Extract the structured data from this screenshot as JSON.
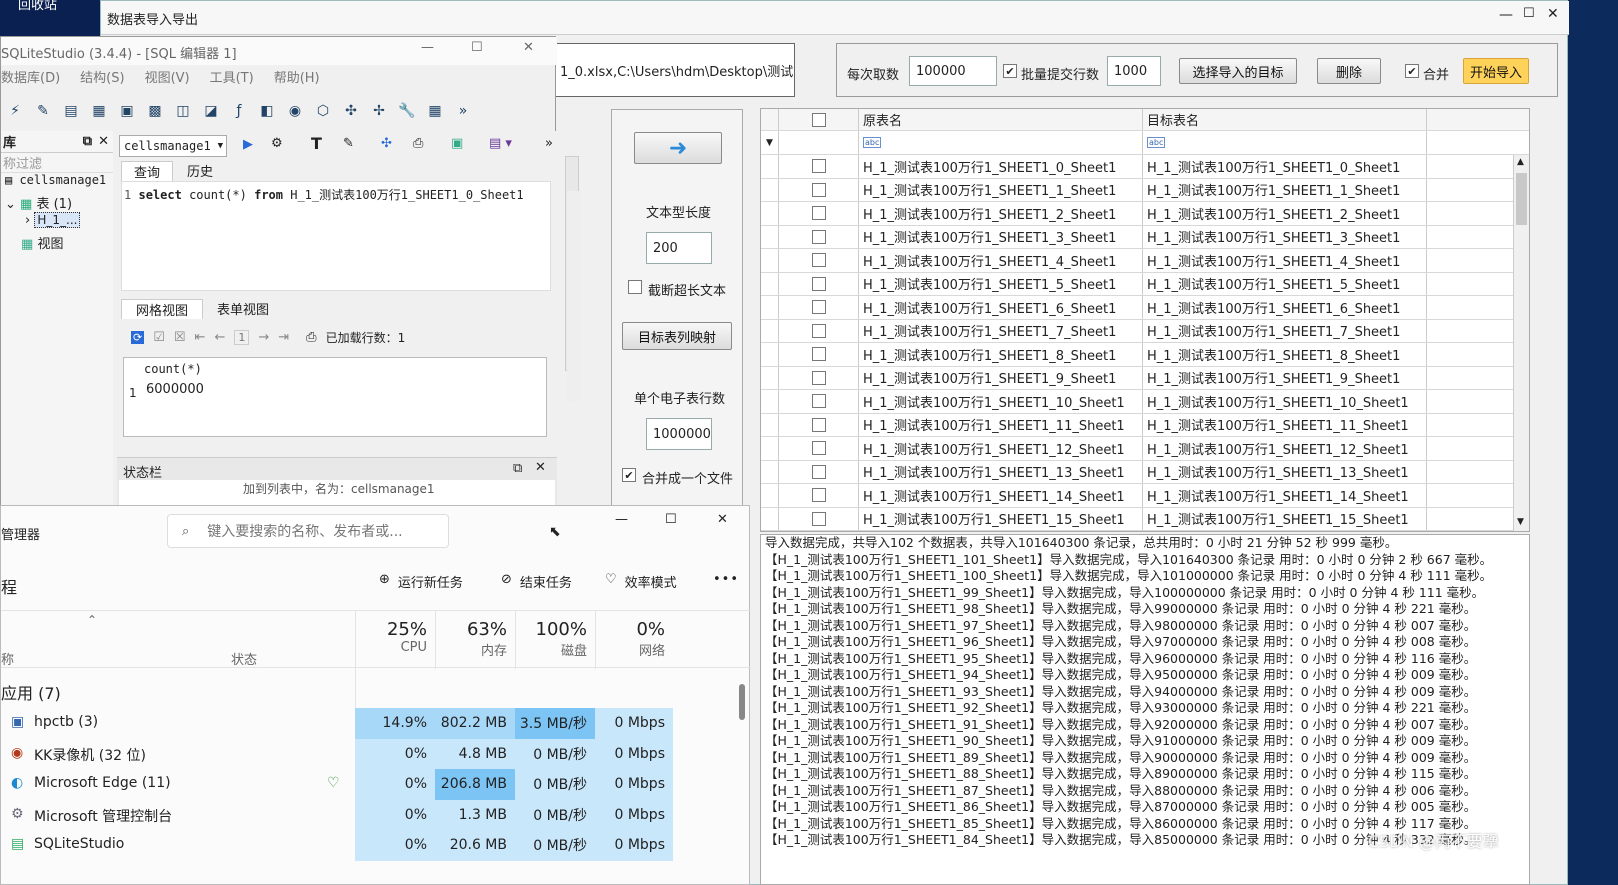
{
  "desktop": {
    "recycle_label": "回收站"
  },
  "importer": {
    "title": "数据表导入导出",
    "path_value": "1_0.xlsx,C:\\Users\\hdm\\Desktop\\测试数",
    "fetch_label": "每次取数",
    "fetch_value": "100000",
    "batch_label": "批量提交行数",
    "batch_value": "1000",
    "select_target_label": "选择导入的目标",
    "delete_label": "删除",
    "merge_label": "合并",
    "start_label": "开始导入",
    "text_len_label": "文本型长度",
    "text_len_value": "200",
    "truncate_label": "截断超长文本",
    "map_label": "目标表列映射",
    "rows_per_sheet_label": "单个电子表行数",
    "rows_per_sheet_value": "1000000",
    "merge_file_label": "合并成一个文件",
    "grid_headers": {
      "source": "原表名",
      "target": "目标表名"
    },
    "grid_rows": [
      "H_1_测试表100万行1_SHEET1_0_Sheet1",
      "H_1_测试表100万行1_SHEET1_1_Sheet1",
      "H_1_测试表100万行1_SHEET1_2_Sheet1",
      "H_1_测试表100万行1_SHEET1_3_Sheet1",
      "H_1_测试表100万行1_SHEET1_4_Sheet1",
      "H_1_测试表100万行1_SHEET1_5_Sheet1",
      "H_1_测试表100万行1_SHEET1_6_Sheet1",
      "H_1_测试表100万行1_SHEET1_7_Sheet1",
      "H_1_测试表100万行1_SHEET1_8_Sheet1",
      "H_1_测试表100万行1_SHEET1_9_Sheet1",
      "H_1_测试表100万行1_SHEET1_10_Sheet1",
      "H_1_测试表100万行1_SHEET1_11_Sheet1",
      "H_1_测试表100万行1_SHEET1_12_Sheet1",
      "H_1_测试表100万行1_SHEET1_13_Sheet1",
      "H_1_测试表100万行1_SHEET1_14_Sheet1",
      "H_1_测试表100万行1_SHEET1_15_Sheet1"
    ],
    "log_lines": [
      "导入数据完成，共导入102 个数据表，共导入101640300 条记录，总共用时：0 小时 21 分钟 52 秒 999 毫秒。",
      "【H_1_测试表100万行1_SHEET1_101_Sheet1】导入数据完成，导入101640300 条记录 用时：0 小时 0 分钟 2 秒 667 毫秒。",
      "【H_1_测试表100万行1_SHEET1_100_Sheet1】导入数据完成，导入101000000 条记录 用时：0 小时 0 分钟 4 秒 111 毫秒。",
      "【H_1_测试表100万行1_SHEET1_99_Sheet1】导入数据完成，导入100000000 条记录 用时：0 小时 0 分钟 4 秒 111 毫秒。",
      "【H_1_测试表100万行1_SHEET1_98_Sheet1】导入数据完成，导入99000000 条记录 用时：0 小时 0 分钟 4 秒 221 毫秒。",
      "【H_1_测试表100万行1_SHEET1_97_Sheet1】导入数据完成，导入98000000 条记录 用时：0 小时 0 分钟 4 秒 007 毫秒。",
      "【H_1_测试表100万行1_SHEET1_96_Sheet1】导入数据完成，导入97000000 条记录 用时：0 小时 0 分钟 4 秒 008 毫秒。",
      "【H_1_测试表100万行1_SHEET1_95_Sheet1】导入数据完成，导入96000000 条记录 用时：0 小时 0 分钟 4 秒 116 毫秒。",
      "【H_1_测试表100万行1_SHEET1_94_Sheet1】导入数据完成，导入95000000 条记录 用时：0 小时 0 分钟 4 秒 009 毫秒。",
      "【H_1_测试表100万行1_SHEET1_93_Sheet1】导入数据完成，导入94000000 条记录 用时：0 小时 0 分钟 4 秒 009 毫秒。",
      "【H_1_测试表100万行1_SHEET1_92_Sheet1】导入数据完成，导入93000000 条记录 用时：0 小时 0 分钟 4 秒 221 毫秒。",
      "【H_1_测试表100万行1_SHEET1_91_Sheet1】导入数据完成，导入92000000 条记录 用时：0 小时 0 分钟 4 秒 007 毫秒。",
      "【H_1_测试表100万行1_SHEET1_90_Sheet1】导入数据完成，导入91000000 条记录 用时：0 小时 0 分钟 4 秒 009 毫秒。",
      "【H_1_测试表100万行1_SHEET1_89_Sheet1】导入数据完成，导入90000000 条记录 用时：0 小时 0 分钟 4 秒 009 毫秒。",
      "【H_1_测试表100万行1_SHEET1_88_Sheet1】导入数据完成，导入89000000 条记录 用时：0 小时 0 分钟 4 秒 115 毫秒。",
      "【H_1_测试表100万行1_SHEET1_87_Sheet1】导入数据完成，导入88000000 条记录 用时：0 小时 0 分钟 4 秒 006 毫秒。",
      "【H_1_测试表100万行1_SHEET1_86_Sheet1】导入数据完成，导入87000000 条记录 用时：0 小时 0 分钟 4 秒 005 毫秒。",
      "【H_1_测试表100万行1_SHEET1_85_Sheet1】导入数据完成，导入86000000 条记录 用时：0 小时 0 分钟 4 秒 117 毫秒。",
      "【H_1_测试表100万行1_SHEET1_84_Sheet1】导入数据完成，导入85000000 条记录 用时：0 小时 0 分钟 4 秒 332 毫秒。"
    ]
  },
  "sqlite": {
    "title": "SQLiteStudio (3.4.4) - [SQL 编辑器 1]",
    "menu": [
      "数据库(D)",
      "结构(S)",
      "视图(V)",
      "工具(T)",
      "帮助(H)"
    ],
    "db_panel_title": "库",
    "filter_placeholder": "称过滤",
    "db_name": "cellsmanage1",
    "tables_label": "表 (1)",
    "table_item": "H_1_...",
    "views_label": "视图",
    "db_select": "cellsmanage1",
    "tab_query": "查询",
    "tab_history": "历史",
    "sql_line_no": "1",
    "sql_kw1": "select",
    "sql_mid": "count(*)",
    "sql_kw2": "from",
    "sql_table": "H_1_测试表100万行1_SHEET1_0_Sheet1",
    "tab_grid": "网格视图",
    "tab_form": "表单视图",
    "page_no": "1",
    "loaded_rows": "已加载行数：1",
    "result_header": "count(*)",
    "result_row_no": "1",
    "result_value": "6000000",
    "status_title": "状态栏",
    "status_text": "加到列表中，名为：cellsmanage1"
  },
  "taskmgr": {
    "title": "管理器",
    "search_placeholder": "键入要搜索的名称、发布者或...",
    "section_label": "程",
    "run_task": "运行新任务",
    "end_task": "结束任务",
    "efficiency": "效率模式",
    "more": "•••",
    "col_name": "称",
    "col_status": "状态",
    "cpu_pct": "25%",
    "cpu_label": "CPU",
    "mem_pct": "63%",
    "mem_label": "内存",
    "disk_pct": "100%",
    "disk_label": "磁盘",
    "net_pct": "0%",
    "net_label": "网络",
    "group_label": "应用 (7)",
    "rows": [
      {
        "name": "hpctb (3)",
        "cpu": "14.9%",
        "mem": "802.2 MB",
        "disk": "3.5 MB/秒",
        "net": "0 Mbps"
      },
      {
        "name": "KK录像机 (32 位)",
        "cpu": "0%",
        "mem": "4.8 MB",
        "disk": "0 MB/秒",
        "net": "0 Mbps"
      },
      {
        "name": "Microsoft Edge (11)",
        "cpu": "0%",
        "mem": "206.8 MB",
        "disk": "0 MB/秒",
        "net": "0 Mbps"
      },
      {
        "name": "Microsoft 管理控制台",
        "cpu": "0%",
        "mem": "1.3 MB",
        "disk": "0 MB/秒",
        "net": "0 Mbps"
      },
      {
        "name": "SQLiteStudio",
        "cpu": "0%",
        "mem": "20.6 MB",
        "disk": "0 MB/秒",
        "net": "0 Mbps"
      }
    ]
  },
  "watermark": "CSDN @丙不要犟",
  "colors": {
    "tm_light": "#c9e7fb",
    "tm_mid": "#a8d8f8",
    "tm_hot": "#7cc4f4",
    "start_btn": "#ffd25a"
  }
}
